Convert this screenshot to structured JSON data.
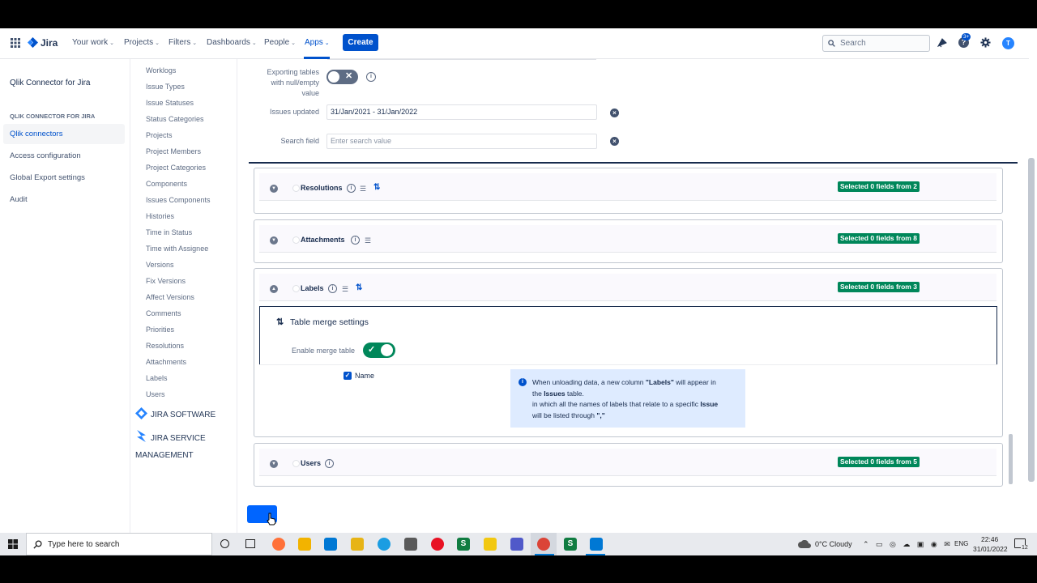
{
  "nav": {
    "brand": "Jira",
    "items": [
      {
        "label": "Your work",
        "chev": "⌄"
      },
      {
        "label": "Projects",
        "chev": "⌄"
      },
      {
        "label": "Filters",
        "chev": "⌄"
      },
      {
        "label": "Dashboards",
        "chev": "⌄"
      },
      {
        "label": "People",
        "chev": "⌄"
      },
      {
        "label": "Apps",
        "chev": "⌄"
      }
    ],
    "create_label": "Create",
    "search_placeholder": "Search",
    "help_badge": "3+",
    "avatar_initials": "T"
  },
  "sidebar": {
    "app_title": "Qlik Connector for Jira",
    "section_heading": "QLIK CONNECTOR FOR JIRA",
    "items": [
      "Qlik connectors",
      "Access configuration",
      "Global Export settings",
      "Audit"
    ],
    "active_item": "Qlik connectors"
  },
  "tables_list": {
    "items": [
      "Worklogs",
      "Issue Types",
      "Issue Statuses",
      "Status Categories",
      "Projects",
      "Project Members",
      "Project Categories",
      "Components",
      "Issues Components",
      "Histories",
      "Time in Status",
      "Time with Assignee",
      "Versions",
      "Fix Versions",
      "Affect Versions",
      "Comments",
      "Priorities",
      "Resolutions",
      "Attachments",
      "Labels",
      "Users"
    ],
    "jira_software": "JIRA SOFTWARE",
    "jira_service_1": "JIRA SERVICE",
    "jira_service_2": "MANAGEMENT"
  },
  "settings": {
    "null_label_1": "Exporting tables",
    "null_label_2": "with null/empty",
    "null_label_3": "value",
    "null_toggle": false,
    "issues_updated_label": "Issues updated",
    "issues_updated_value": "31/Jan/2021 - 31/Jan/2022",
    "search_field_label": "Search field",
    "search_field_placeholder": "Enter search value"
  },
  "cards": {
    "resolutions": {
      "title": "Resolutions",
      "badge": "Selected 0 fields from 2"
    },
    "attachments": {
      "title": "Attachments",
      "badge": "Selected 0 fields from 8"
    },
    "labels": {
      "title": "Labels",
      "badge": "Selected 0 fields from 3"
    },
    "users": {
      "title": "Users",
      "badge": "Selected 0 fields from 5"
    }
  },
  "merge": {
    "title": "Table merge settings",
    "enable_label": "Enable merge table",
    "enabled": true,
    "field_name": "Name",
    "info_line1_a": "When unloading data, a new column ",
    "info_line1_b": "\"Labels\"",
    "info_line1_c": " will appear in",
    "info_line2_a": "the ",
    "info_line2_b": "Issues",
    "info_line2_c": " table.",
    "info_line3_a": "in which all the names of labels that relate to a specific ",
    "info_line3_b": "Issue",
    "info_line4_a": "will be listed through ",
    "info_line4_b": "\",\""
  },
  "taskbar": {
    "search_placeholder": "Type here to search",
    "weather": "0°C  Cloudy",
    "lang": "ENG",
    "time": "22:46",
    "date": "31/01/2022",
    "notif_count": "12"
  },
  "colors": {
    "accent": "#0052cc",
    "success": "#00875a",
    "sidebar_active_bg": "#f4f5f7"
  }
}
